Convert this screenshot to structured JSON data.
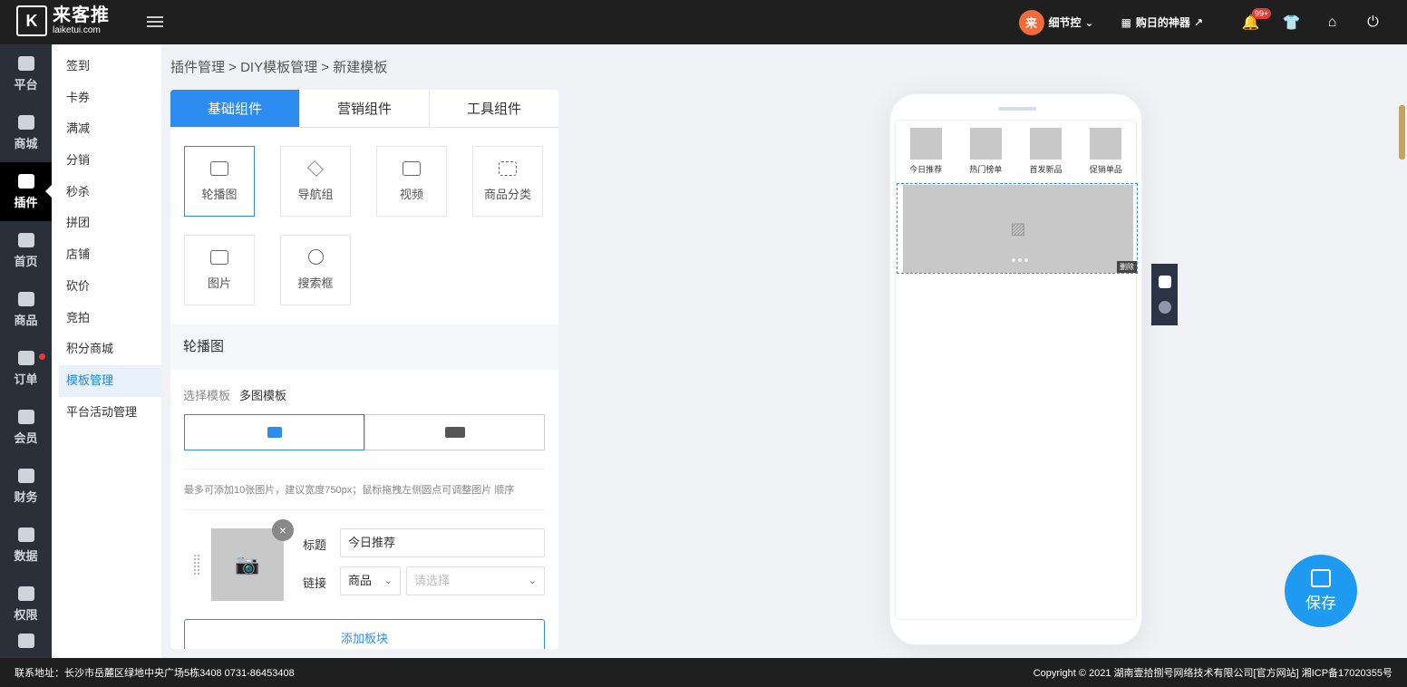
{
  "header": {
    "logo_mark": "K",
    "logo_cn": "来客推",
    "logo_en": "laiketui.com",
    "user_avatar": "来",
    "user_name": "细节控",
    "shop_label": "购日的神器",
    "badge": "99+"
  },
  "sidebar": {
    "items": [
      {
        "label": "平台",
        "icon": "platform-icon"
      },
      {
        "label": "商城",
        "icon": "mall-icon"
      },
      {
        "label": "插件",
        "icon": "puzzle-icon"
      },
      {
        "label": "首页",
        "icon": "home-icon"
      },
      {
        "label": "商品",
        "icon": "bag-icon"
      },
      {
        "label": "订单",
        "icon": "clipboard-icon"
      },
      {
        "label": "会员",
        "icon": "user-icon"
      },
      {
        "label": "财务",
        "icon": "wallet-icon"
      },
      {
        "label": "数据",
        "icon": "pie-chart-icon"
      },
      {
        "label": "权限",
        "icon": "shield-icon"
      }
    ]
  },
  "submenu": {
    "items": [
      "签到",
      "卡券",
      "满减",
      "分销",
      "秒杀",
      "拼团",
      "店铺",
      "砍价",
      "竞拍",
      "积分商城",
      "模板管理",
      "平台活动管理"
    ]
  },
  "breadcrumb": "插件管理 > DIY模板管理 > 新建模板",
  "tabs": [
    "基础组件",
    "营销组件",
    "工具组件"
  ],
  "components": [
    "轮播图",
    "导航组",
    "视频",
    "商品分类",
    "图片",
    "搜索框"
  ],
  "editor": {
    "section_title": "轮播图",
    "template_label": "选择模板",
    "template_value": "多图模板",
    "hint": "最多可添加10张图片，建议宽度750px；鼠标拖拽左侧圆点可调整图片 顺序",
    "title_label": "标题",
    "title_value": "今日推荐",
    "link_label": "链接",
    "link_type": "商品",
    "link_placeholder": "请选择",
    "add_block": "添加板块"
  },
  "preview": {
    "nav": [
      "今日推荐",
      "热门榜单",
      "首发新品",
      "促销单品"
    ],
    "delete_tag": "删除"
  },
  "save_label": "保存",
  "footer": {
    "left": "联系地址：长沙市岳麓区绿地中央广场5栋3408 0731-86453408",
    "right": "Copyright © 2021 湖南壹拾捌号网络技术有限公司[官方网站]   湘ICP备17020355号"
  },
  "colors": {
    "accent": "#2d8cf0",
    "topbar": "#1f1f1f",
    "sidebar": "#2b2f3a",
    "save": "#1e9bf0"
  }
}
